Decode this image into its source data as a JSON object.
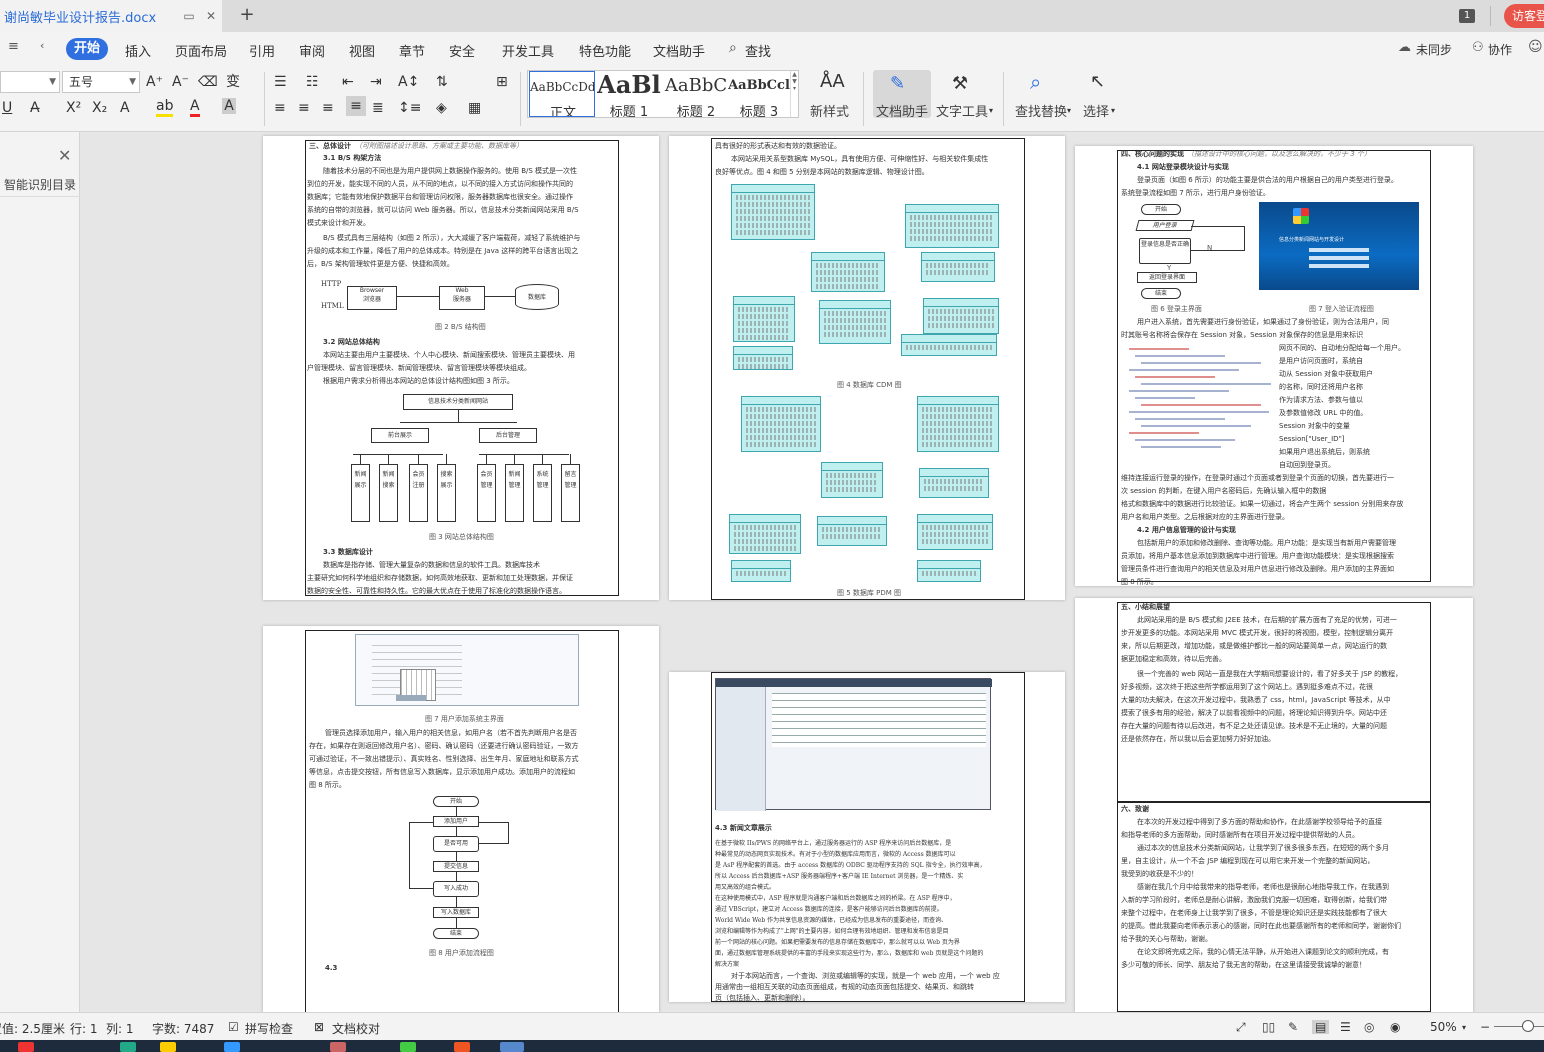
{
  "titlebar": {
    "doc_name": "谢尚敏毕业设计报告.docx",
    "tab_count": "1",
    "visitor": "访客登"
  },
  "menu": {
    "start": "开始",
    "items": [
      "插入",
      "页面布局",
      "引用",
      "审阅",
      "视图",
      "章节",
      "安全",
      "开发工具",
      "特色功能",
      "文档助手"
    ],
    "search": "查找",
    "sync": "未同步",
    "collab": "协作"
  },
  "ribbon": {
    "font_size": "五号",
    "styles": [
      {
        "sample": "AaBbCcDd",
        "label": "正文"
      },
      {
        "sample": "AaBl",
        "label": "标题 1"
      },
      {
        "sample": "AaBbC",
        "label": "标题 2"
      },
      {
        "sample": "AaBbCcl",
        "label": "标题 3"
      }
    ],
    "new_style": "新样式",
    "doc_assist": "文档助手",
    "text_tools": "文字工具",
    "find_replace": "查找替换",
    "select": "选择"
  },
  "sidebar": {
    "title": "智能识别目录"
  },
  "pages": {
    "p1": {
      "h1": "三、总体设计",
      "h1_note": "（可附图描述设计思路、方案或主要功能、数据库等）",
      "h2": "3.1 B/S 构架方法",
      "p1a": "随着技术分层的不同也是为用户提供网上数据操作服务的。使用 B/S 模式是一次性",
      "p1b": "到位的开发，能实现不同的人员，从不同的地点，以不同的接入方式访问和操作共同的",
      "p1c": "数据库；它能有效地保护数据平台和管理访问权限，服务器数据库也很安全。通过操作",
      "p1d": "系统的自带的浏览器，就可以访问 Web 服务器。所以，信息技术分类新闻网站采用 B/S",
      "p1e": "模式来设计和开发。",
      "p2a": "B/S 模式具有三层结构（如图 2 所示），大大减缓了客户端载荷，减轻了系统维护与",
      "p2b": "升级的成本和工作量，降低了用户的总体成本。特别是在 Java 这样的跨平台语言出现之",
      "p2c": "后，B/S 架构管理软件更是方便、快捷和高效。",
      "fig2_http": "HTTP",
      "fig2_html": "HTML",
      "fig2_browser": "Browser",
      "fig2_browser2": "浏览器",
      "fig2_web": "Web",
      "fig2_web2": "服务器",
      "fig2_db": "数据库",
      "fig2_cap": "图 2   B/S 结构图",
      "h3": "3.2 网站总体结构",
      "p3a": "本网站主要由用户主要模块、个人中心模块、新闻搜索模块、管理员主要模块、用",
      "p3b": "户管理模块、留言管理模块、新闻管理模块、留言管理模块等模块组成。",
      "p3c": "根据用户需求分析得出本网站的总体设计结构图如图 3 所示。",
      "fig3_root": "信息技术分类新闻网站",
      "fig3_front": "前台展示",
      "fig3_back": "后台管理",
      "fig3_leaves": [
        "新闻展示",
        "新闻搜索",
        "会员注册",
        "搜索展示",
        "会员管理",
        "新闻管理",
        "系统管理",
        "留言管理"
      ],
      "fig3_cap": "图 3   网站总体结构图",
      "h4": "3.3 数据库设计",
      "p4a": "数据库是指存储、管理大量复杂的数据和信息的软件工具。数据库技术",
      "p4b": "主要研究如何科学地组织和存储数据，如何高效地获取、更新和加工处理数据，并保证",
      "p4c": "数据的安全性、可靠性和持久性。它的最大优点在于使用了标准化的数据操作语言。"
    },
    "p2": {
      "p1a": "具有很好的形式表达和有效的数据验证。",
      "p1b": "本网站采用关系型数据库 MySQL，具有使用方便、可伸缩性好、与相关软件集成性",
      "p1c": "良好等优点。图 4 和图 5 分别是本网站的数据库逻辑、物理设计图。",
      "fig4_cap": "图 4   数据库 CDM 图",
      "fig5_cap": "图 5   数据库 PDM 图"
    },
    "p3": {
      "h1": "四、核心问题的实现",
      "h1_note": "（描述设计中的核心问题，以及怎么解决的，不少于 3 个）",
      "h2": "4.1 网站登录模块设计与实现",
      "p1a": "登录页面（如图 6 所示）的功能主要是供合法的用户根据自己的用户类型进行登录。",
      "p1b": "系统登录流程如图 7 所示，进行用户身份验证。",
      "fl_start": "开始",
      "fl_input": "用户登录",
      "fl_check": "登录信息是否正确",
      "fl_ok": "返回登录界面",
      "fl_end": "结束",
      "fl_y": "Y",
      "fl_n": "N",
      "login_title": "信息分类新闻网站与开发设计",
      "fig6_cap": "图 6   登录主界面",
      "fig7_cap": "图 7   登入验证流程图",
      "p2a": "用户进入系统，首先需要进行身份验证，如果通过了身份验证，则为合法用户，同",
      "p2b": "时其账号名称将会保存在 Session 对象，Session 对象保存的信息是用来标识",
      "p2c": "网页不同的、自动地分配给每一个用户。",
      "p2d": "是用户访问页面时，系统自",
      "p2e": "动从 Session 对象中获取用户",
      "p2f": "的名称，同时还将用户名称",
      "p2g": "作为请求方法、参数与值以",
      "p2h": "及参数值修改 URL 中的值。",
      "p2i": "Session 对象中的变量",
      "p2j": "Session[\"User_ID\"]",
      "p2k": "如果用户退出系统后，则系统",
      "p2l": "自动回到登录页。",
      "p3a": "维持连接运行登录的操作，在登录时通过个页面或者到登录个页面的切换，首先要进行一",
      "p3b": "次 session 的判断，在键入用户名密码后，先确认输入框中的数据",
      "p3c": "格式和数据库中的数据进行比较验证。如果一切通过，将会产生两个 session 分别用来存放",
      "p3d": "用户名和用户类型。之后根据对应的主界面进行登录。",
      "h3": "4.2 用户信息管理的设计与实现",
      "p4a": "包括新用户的添加和修改删除、查询等功能。用户功能：是实现当有新用户需要管理",
      "p4b": "员添加，将用户基本信息添加到数据库中进行管理。用户查询功能模块：是实现根据搜索",
      "p4c": "管理员条件进行查询用户的相关信息及对用户信息进行修改及删除。用户添加的主界面如",
      "p4d": "图 8 所示。"
    },
    "p4": {
      "fig7b_cap": "图 7   用户添加系统主界面",
      "p1a": "管理员选择添加用户，输入用户的相关信息，如用户名（若不首先判断用户名是否",
      "p1b": "存在，如果存在则返回修改用户名）、密码、确认密码（还要进行确认密码验证，一致方",
      "p1c": "可通过验证，不一致出错提示）、真实姓名、性别选择、出生年月、家庭地址和联系方式",
      "p1d": "等信息，点击提交按钮，所有信息写入数据库，显示添加用户成功。添加用户的流程如",
      "p1e": "图 8 所示。",
      "fl_start": "开始",
      "fl_add": "添加用户",
      "fl_check": "是否可用",
      "fl_submit": "提交信息",
      "fl_dbcheck": "写入成功",
      "fl_save": "写入数据库",
      "fl_end": "结束",
      "fig8_cap": "图 8   用户添加流程图",
      "h4_3": "4.3"
    },
    "p5": {
      "h": "4.3 新闻文章展示",
      "p1a": "在基于微软 IIs/PWS 的网络平台上，通过服务器运行的 ASP 程序来访问后台数据库，是",
      "p1b": "种最常见的动态网页实现技术。有对于小型的数据库应用而言，微软的 Access 数据库可以",
      "p1c": "是 AsP 程序配套的首选。由于 access 数据库的 ODBC 驱动程序支持的 SQL 指令全，执行效率高，",
      "p1d": "所以 Access 后台数据库+ASP 服务器端程序+客户端 IE Internet 浏览器，是一个精炼、实",
      "p1e": "用又高效的组合模式。",
      "p1f": "在这种使用模式中，ASP 程序就是沟通客户端和后台数据库之间的桥梁。在 ASP 程序中，",
      "p1g": "通过 VBScript，建立对 Access 数据库的连接，是客户能够访问后台数据库的前提。",
      "p1h": "World Wide Web 作为共享信息资源的媒体，已经成为信息发布的重要途径，而查询、",
      "p1i": "浏览和编辑等作为构成了\"上网\"的主要内容，如何合理有效地组织、管理和发布信息是目",
      "p1j": "前一个网站的核心问题。如果把需要发布的信息存储在数据库中，那么就可以以 Web 页为界",
      "p1k": "面，通过数据库管理系统提供的丰富的手段来实现这些行为，那么，数据库和 web 页就是这个问题的",
      "p1l": "解决方案",
      "p2a": "对于本网站而言，一个查询、浏览或编辑等的实现，就是一个 web 应用，一个 web 应",
      "p2b": "用通常由一组相互关联的动态页面组成，有规的动态页面包括提交、结果页、和跳转",
      "p2c": "页（包括插入、更新和删除）。"
    },
    "p6": {
      "h1": "五、小结和展望",
      "p1a": "此网站采用的是 B/S 模式和 J2EE 技术，在后期的扩展方面有了充足的优势，可进一",
      "p1b": "步开发更多的功能。本网站采用 MVC 模式开发，很好的将视图，模型，控制逻辑分离开",
      "p1c": "来，所以后期更改，增加功能，或是做维护都比一般的网站要简单一点，网站运行的数",
      "p1d": "据更加稳定和高效，待以后完善。",
      "p2a": "很一个完善的 web 网站一直是我在大学期间想要设计的，看了好多关于 JSP 的教程，",
      "p2b": "好多视频，这次终于把这些所学都运用到了这个网站上。遇到挺多难点不过，花很",
      "p2c": "大量的功夫解决，在这次开发过程中，我熟悉了 css，html，JavaScript 等技术，从中",
      "p2d": "摸索了很多有用的经验，解决了以前看视频中的问题，将理论知识得到升华。网站中还",
      "p2e": "存在大量的问题有待以后改进，有不足之处还请见谅。技术是不无止境的，大量的问题",
      "p2f": "还是依然存在，所以我以后会更加努力好好加油。",
      "h2": "六、致谢",
      "p3a": "在本次的开发过程中得到了多方面的帮助和协作，在此感谢学校领导给予的直接",
      "p3b": "和指导老师的多方面帮助，同时感谢所有在项目开发过程中提供帮助的人员。",
      "p3c": "通过本次的信息技术分类新闻网站，让我学到了很多很多东西，在短短的两个多月",
      "p3d": "里，自主设计，从一个不会 JSP 编程到现在可以用它来开发一个完整的新闻网站，",
      "p3e": "我受到的收获是不少的！",
      "p3f": "感谢在我几个月中给我带来的指导老师，老师也是很耐心地指导我工作，在我遇到",
      "p3g": "入新的学习阶段时，老师总是耐心讲解，激励我们克服一切困难，取得创新，给我们带",
      "p3h": "来整个过程中，在老师身上让我学到了很多，不管是理论知识还是实践技能都有了很大",
      "p3i": "的提高。借此我要向老师表示衷心的感谢，同时在此也要感谢所有的老师和同学，谢谢你们",
      "p3j": "给予我的关心与帮助，谢谢。",
      "p3k": "在论文即将完成之际，我的心情无法平静，从开始进入课题到论文的顺利完成，有",
      "p3l": "多少可敬的师长、同学、朋友给了我无言的帮助，在这里请接受我诚挚的谢意！"
    }
  },
  "status": {
    "pos": "设置值: 2.5厘米",
    "row": "行: 1",
    "col": "列: 1",
    "words": "字数: 7487",
    "spell": "拼写检查",
    "proof": "文档校对",
    "zoom": "50%"
  }
}
